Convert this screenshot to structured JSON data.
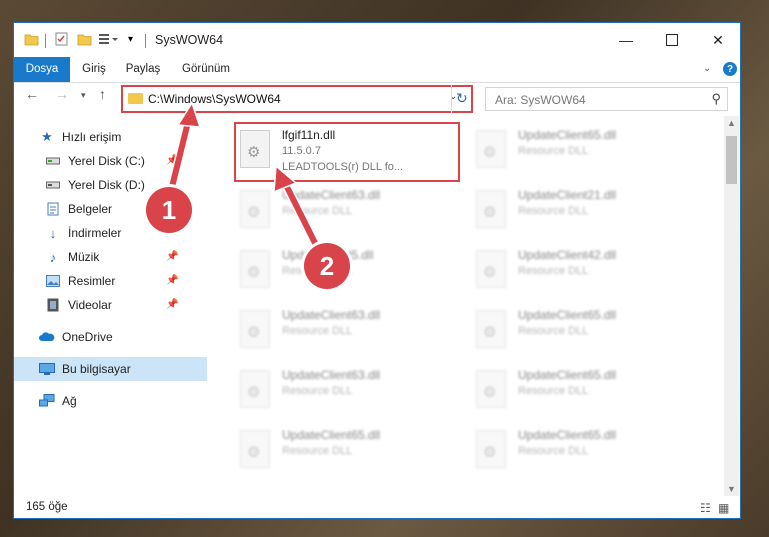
{
  "window": {
    "title": "SysWOW64"
  },
  "ribbon": {
    "tabs": [
      {
        "label": "Dosya",
        "active": true
      },
      {
        "label": "Giriş"
      },
      {
        "label": "Paylaş"
      },
      {
        "label": "Görünüm"
      }
    ],
    "help_label": "?"
  },
  "address": {
    "path": "C:\\Windows\\SysWOW64"
  },
  "search": {
    "placeholder": "Ara: SysWOW64"
  },
  "sidebar": {
    "items": [
      {
        "label": "Hızlı erişim",
        "icon": "star-icon"
      },
      {
        "label": "Yerel Disk (C:)",
        "icon": "drive-icon",
        "pinned": true
      },
      {
        "label": "Yerel Disk (D:)",
        "icon": "drive-icon",
        "pinned": true
      },
      {
        "label": "Belgeler",
        "icon": "documents-icon",
        "pinned": true
      },
      {
        "label": "İndirmeler",
        "icon": "downloads-icon",
        "pinned": true
      },
      {
        "label": "Müzik",
        "icon": "music-icon",
        "pinned": true
      },
      {
        "label": "Resimler",
        "icon": "pictures-icon",
        "pinned": true
      },
      {
        "label": "Videolar",
        "icon": "videos-icon",
        "pinned": true
      },
      {
        "label": "OneDrive",
        "icon": "cloud-icon"
      },
      {
        "label": "Bu bilgisayar",
        "icon": "computer-icon",
        "selected": true
      },
      {
        "label": "Ağ",
        "icon": "network-icon"
      }
    ]
  },
  "files": [
    {
      "name": "lfgif11n.dll",
      "version": "11.5.0.7",
      "desc": "LEADTOOLS(r) DLL fo...",
      "highlight": true
    },
    {
      "name": "UpdateClient65.dll",
      "desc": "Resource DLL"
    },
    {
      "name": "UpdateClient63.dll",
      "desc": "Resource DLL"
    },
    {
      "name": "UpdateClient21.dll",
      "desc": "Resource DLL"
    },
    {
      "name": "UpdateClient5.dll",
      "desc": "Resource DLL"
    },
    {
      "name": "UpdateClient42.dll",
      "desc": "Resource DLL"
    },
    {
      "name": "UpdateClient63.dll",
      "desc": "Resource DLL"
    },
    {
      "name": "UpdateClient65.dll",
      "desc": "Resource DLL"
    },
    {
      "name": "UpdateClient63.dll",
      "desc": "Resource DLL"
    },
    {
      "name": "UpdateClient65.dll",
      "desc": "Resource DLL"
    },
    {
      "name": "UpdateClient65.dll",
      "desc": "Resource DLL"
    },
    {
      "name": "UpdateClient65.dll",
      "desc": "Resource DLL"
    }
  ],
  "status": {
    "count": "165 öğe"
  },
  "callouts": [
    "1",
    "2"
  ],
  "colors": {
    "accent": "#1979ca",
    "highlight": "#d9434a",
    "selected": "#cce4f7"
  }
}
